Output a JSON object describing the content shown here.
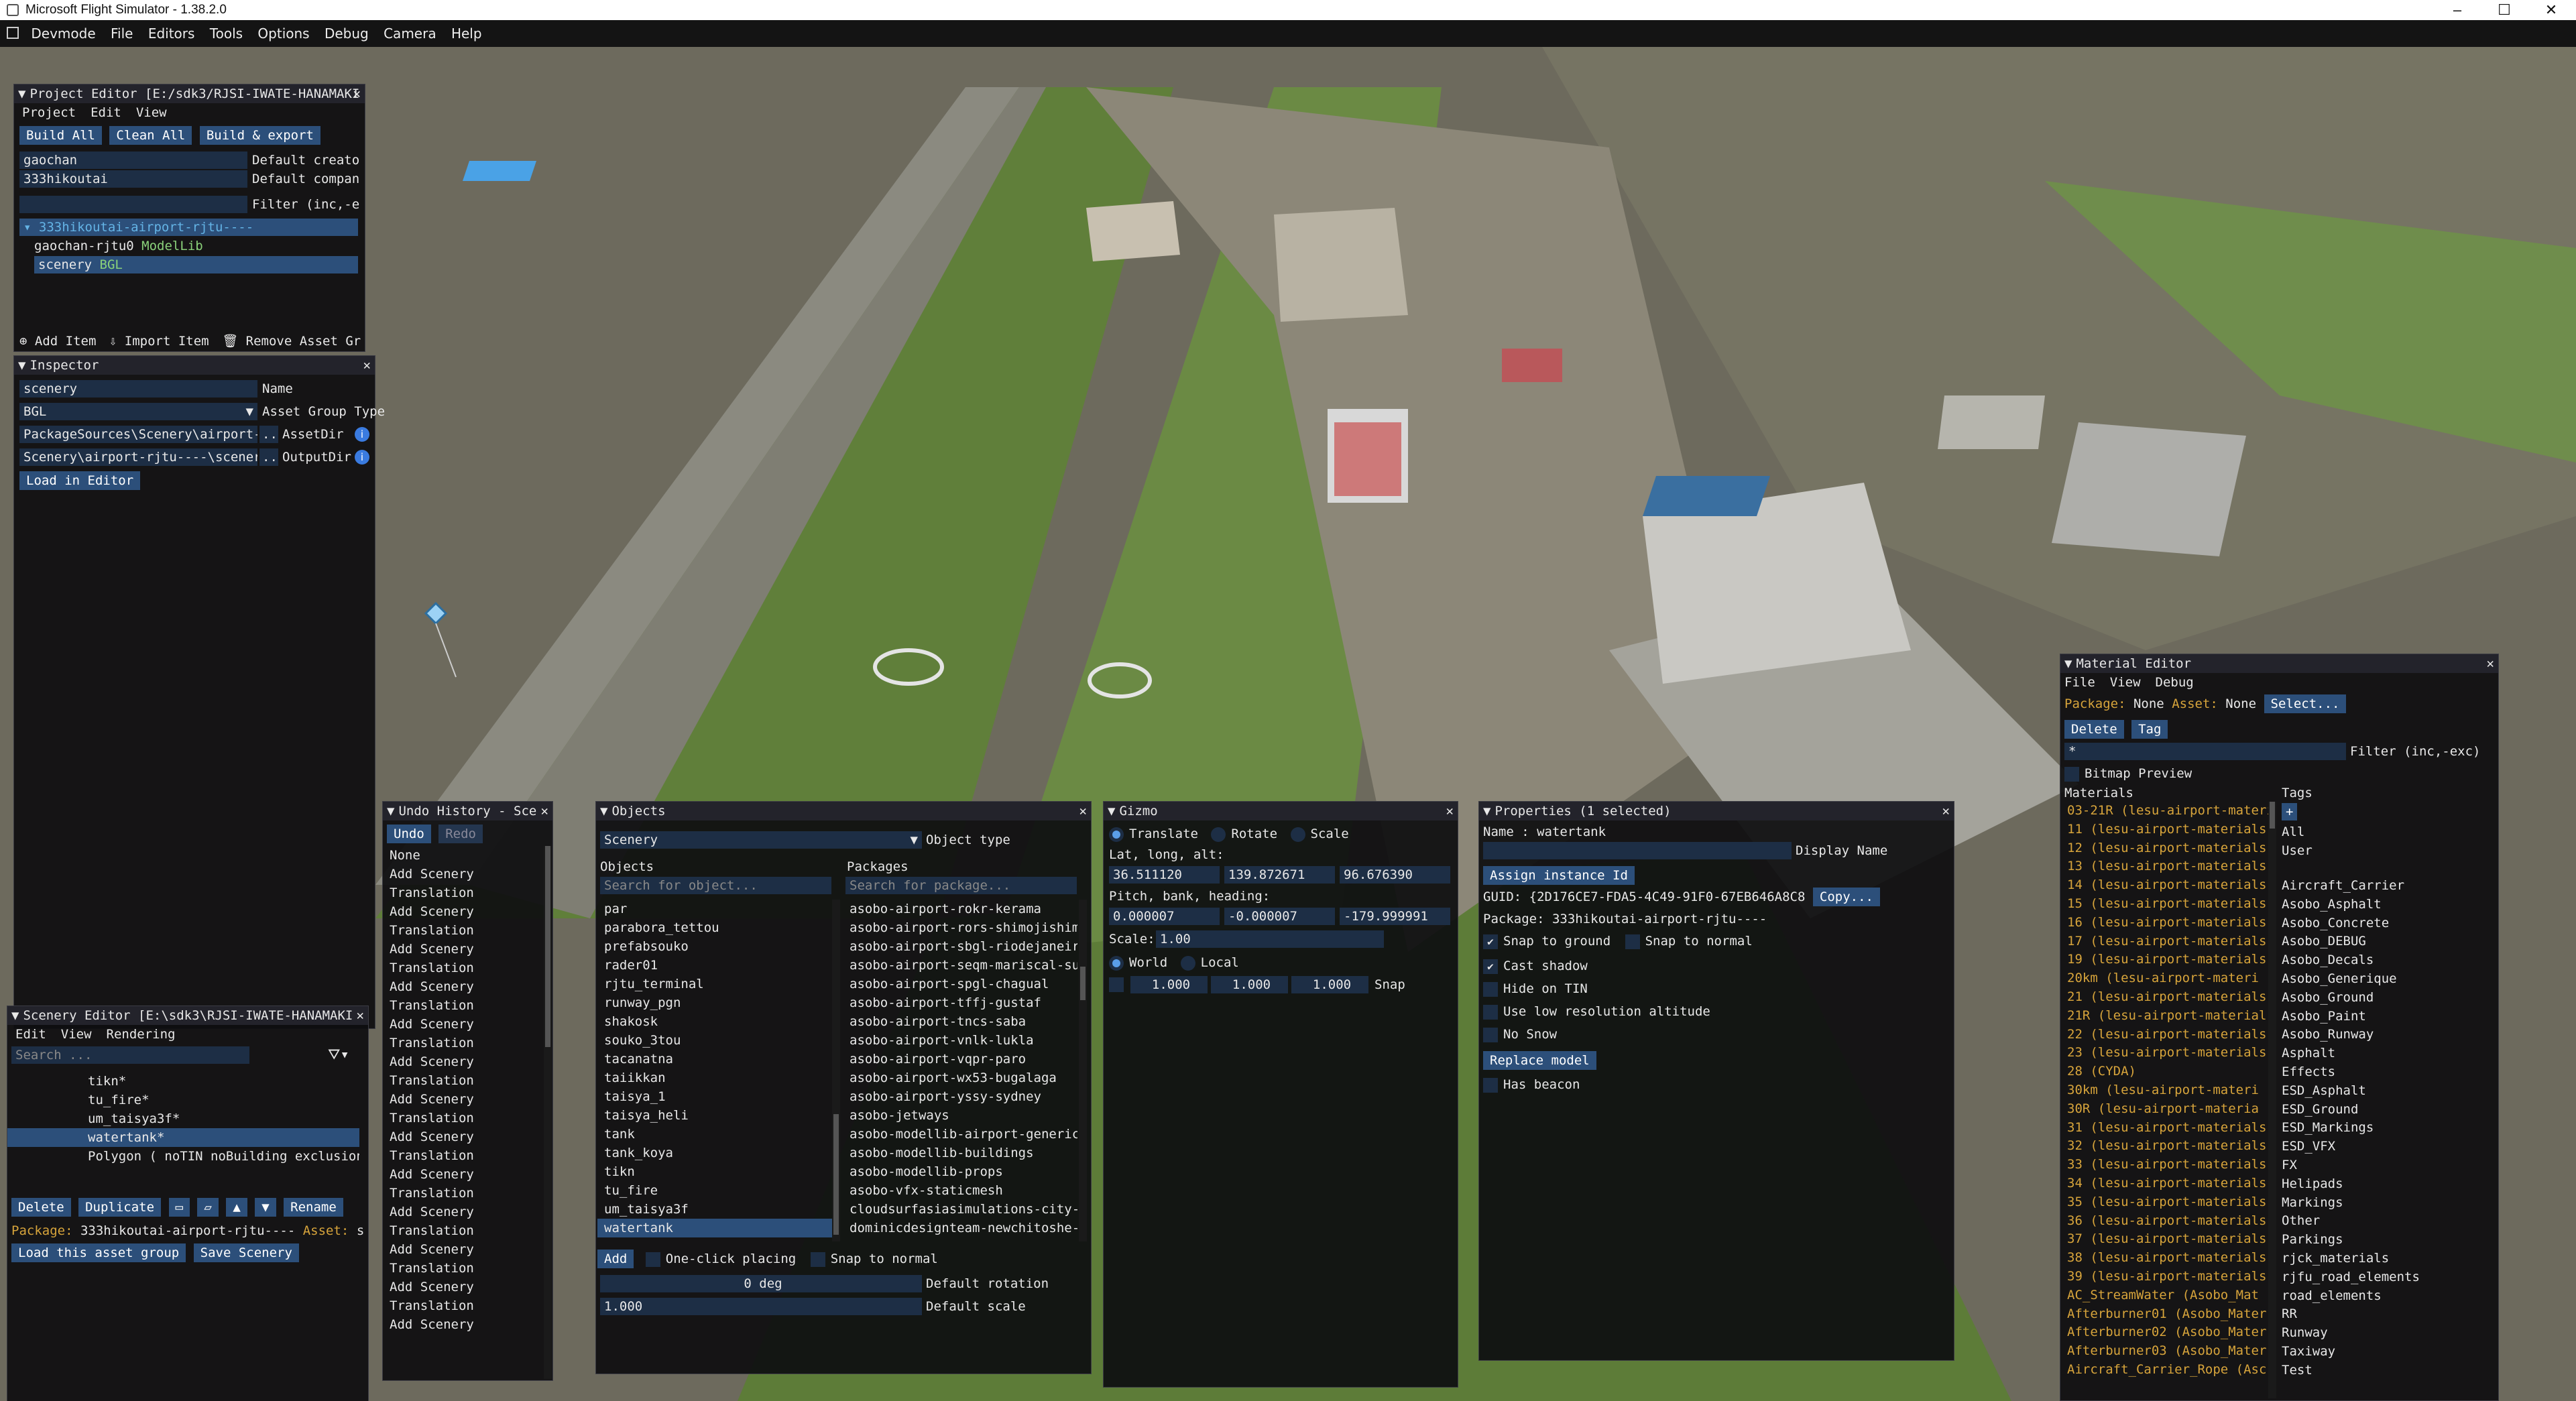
{
  "window": {
    "title": "Microsoft Flight Simulator - 1.38.2.0"
  },
  "menubar": {
    "items": [
      "Devmode",
      "File",
      "Editors",
      "Tools",
      "Options",
      "Debug",
      "Camera",
      "Help"
    ]
  },
  "project_editor": {
    "title": "Project Editor [E:/sdk3/RJSI-IWATE-HANAMAKI",
    "menu": [
      "Project",
      "Edit",
      "View"
    ],
    "buttons": [
      "Build All",
      "Clean All",
      "Build & export"
    ],
    "creator_value": "gaochan",
    "creator_label": "Default creato",
    "company_value": "333hikoutai",
    "company_label": "Default compan",
    "filter_label": "Filter (inc,-e",
    "tree_root": "333hikoutai-airport-rjtu----",
    "tree_items": [
      {
        "name": "gaochan-rjtu0",
        "type": "ModelLib"
      },
      {
        "name": "scenery",
        "type": "BGL"
      }
    ],
    "footer_buttons": [
      "Add Item",
      "Import Item",
      "Remove Asset Gr"
    ]
  },
  "inspector": {
    "title": "Inspector",
    "name_value": "scenery",
    "name_label": "Name",
    "type_value": "BGL",
    "type_label": "Asset Group Type",
    "assetdir_value": "PackageSources\\Scenery\\airport-r",
    "assetdir_label": "AssetDir",
    "outputdir_value": "Scenery\\airport-rjtu----\\scenery",
    "outputdir_label": "OutputDir",
    "dots": "..",
    "load_button": "Load in Editor"
  },
  "scenery_editor": {
    "title": "Scenery Editor [E:\\sdk3\\RJSI-IWATE-HANAMAKI",
    "menu": [
      "Edit",
      "View",
      "Rendering"
    ],
    "search_placeholder": "Search ...",
    "items": [
      "tikn*",
      "tu_fire*",
      "um_taisya3f*",
      "watertank*",
      "Polygon  ( noTIN noBuilding exclusion"
    ],
    "selected_index": 3,
    "buttons": {
      "delete": "Delete",
      "duplicate": "Duplicate",
      "rename": "Rename"
    },
    "package_label": "Package:",
    "package_value": "333hikoutai-airport-rjtu----",
    "asset_label": "Asset:",
    "asset_value": "sc",
    "load_button": "Load this asset group",
    "save_button": "Save Scenery"
  },
  "undo_history": {
    "title": "Undo History - Sce",
    "undo": "Undo",
    "redo": "Redo",
    "items": [
      "None",
      "Add Scenery",
      "Translation",
      "Add Scenery",
      "Translation",
      "Add Scenery",
      "Translation",
      "Add Scenery",
      "Translation",
      "Add Scenery",
      "Translation",
      "Add Scenery",
      "Translation",
      "Add Scenery",
      "Translation",
      "Add Scenery",
      "Translation",
      "Add Scenery",
      "Translation",
      "Add Scenery",
      "Translation",
      "Add Scenery",
      "Translation",
      "Add Scenery",
      "Translation",
      "Add Scenery"
    ]
  },
  "objects": {
    "title": "Objects",
    "type_value": "Scenery",
    "type_label": "Object type",
    "objects_header": "Objects",
    "packages_header": "Packages",
    "search_object_placeholder": "Search for object...",
    "search_package_placeholder": "Search for package...",
    "object_list": [
      "par",
      "parabora_tettou",
      "prefabsouko",
      "rader01",
      "rjtu_terminal",
      "runway_pgn",
      "shakosk",
      "souko_3tou",
      "tacanatna",
      "taiikkan",
      "taisya_1",
      "taisya_heli",
      "tank",
      "tank_koya",
      "tikn",
      "tu_fire",
      "um_taisya3f",
      "watertank"
    ],
    "selected_object": 17,
    "package_list": [
      "asobo-airport-rokr-kerama",
      "asobo-airport-rors-shimojishim",
      "asobo-airport-sbgl-riodejaneir",
      "asobo-airport-seqm-mariscal-su",
      "asobo-airport-spgl-chagual",
      "asobo-airport-tffj-gustaf",
      "asobo-airport-tncs-saba",
      "asobo-airport-vnlk-lukla",
      "asobo-airport-vqpr-paro",
      "asobo-airport-wx53-bugalaga",
      "asobo-airport-yssy-sydney",
      "asobo-jetways",
      "asobo-modellib-airport-generic",
      "asobo-modellib-buildings",
      "asobo-modellib-props",
      "asobo-vfx-staticmesh",
      "cloudsurfasiasimulations-city-",
      "dominicdesignteam-newchitoshe-"
    ],
    "add_button": "Add",
    "one_click": "One-click placing",
    "snap_normal": "Snap to normal",
    "rotation_value": "0 deg",
    "rotation_label": "Default rotation",
    "scale_value": "1.000",
    "scale_label": "Default scale"
  },
  "gizmo": {
    "title": "Gizmo",
    "modes": [
      "Translate",
      "Rotate",
      "Scale"
    ],
    "active_mode": 0,
    "latlong_label": "Lat, long, alt:",
    "lat": "36.511120",
    "lon": "139.872671",
    "alt": "96.676390",
    "pbh_label": "Pitch, bank, heading:",
    "pitch": "0.000007",
    "bank": "-0.000007",
    "heading": "-179.999991",
    "scale_label": "Scale:",
    "scale_value": "1.00",
    "spaces": [
      "World",
      "Local"
    ],
    "active_space": 0,
    "snap_values": [
      "1.000",
      "1.000",
      "1.000"
    ],
    "snap_label": "Snap"
  },
  "properties": {
    "title": "Properties (1 selected)",
    "name_line": "Name : watertank",
    "display_name_label": "Display Name",
    "assign_button": "Assign instance Id",
    "guid_line": "GUID: {2D176CE7-FDA5-4C49-91F0-67EB646A8C8",
    "copy_button": "Copy...",
    "package_line": "Package: 333hikoutai-airport-rjtu----",
    "snap_ground": "Snap to ground",
    "snap_normal": "Snap to normal",
    "checks": [
      {
        "label": "Cast shadow",
        "checked": true
      },
      {
        "label": "Hide on TIN",
        "checked": false
      },
      {
        "label": "Use low resolution altitude",
        "checked": false
      },
      {
        "label": "No Snow",
        "checked": false
      }
    ],
    "replace_button": "Replace model",
    "has_beacon": "Has beacon"
  },
  "material_editor": {
    "title": "Material Editor",
    "menu": [
      "File",
      "View",
      "Debug"
    ],
    "package_label": "Package:",
    "package_value": "None",
    "asset_label": "Asset:",
    "asset_value": "None",
    "select_button": "Select...",
    "delete_button": "Delete",
    "tag_button": "Tag",
    "filter_value": "*",
    "filter_label": "Filter (inc,-exc)",
    "bitmap_preview": "Bitmap Preview",
    "materials_header": "Materials",
    "tags_header": "Tags",
    "materials": [
      "03-21R (lesu-airport-materi",
      "11 (lesu-airport-materials",
      "12 (lesu-airport-materials",
      "13 (lesu-airport-materials",
      "14 (lesu-airport-materials",
      "15 (lesu-airport-materials",
      "16 (lesu-airport-materials",
      "17 (lesu-airport-materials",
      "19 (lesu-airport-materials",
      "20km (lesu-airport-materi",
      "21 (lesu-airport-materials",
      "21R (lesu-airport-material",
      "22 (lesu-airport-materials",
      "23 (lesu-airport-materials",
      "28 (CYDA)",
      "30km (lesu-airport-materi",
      "30R (lesu-airport-materia",
      "31 (lesu-airport-materials",
      "32 (lesu-airport-materials",
      "33 (lesu-airport-materials",
      "34 (lesu-airport-materials",
      "35 (lesu-airport-materials",
      "36 (lesu-airport-materials",
      "37 (lesu-airport-materials",
      "38 (lesu-airport-materials",
      "39 (lesu-airport-materials",
      "AC_StreamWater (Asobo_Mat",
      "Afterburner01 (Asobo_Mater",
      "Afterburner02 (Asobo_Mater",
      "Afterburner03 (Asobo_Mater",
      "Aircraft_Carrier_Rope (Asc"
    ],
    "tag_add": "+",
    "tags_top": [
      "All",
      "User"
    ],
    "tags": [
      "Aircraft_Carrier",
      "Asobo_Asphalt",
      "Asobo_Concrete",
      "Asobo_DEBUG",
      "Asobo_Decals",
      "Asobo_Generique",
      "Asobo_Ground",
      "Asobo_Paint",
      "Asobo_Runway",
      "Asphalt",
      "Effects",
      "ESD_Asphalt",
      "ESD_Ground",
      "ESD_Markings",
      "ESD_VFX",
      "FX",
      "Helipads",
      "Markings",
      "Other",
      "Parkings",
      "rjck_materials",
      "rjfu_road_elements",
      "road_elements",
      "RR",
      "Runway",
      "Taxiway",
      "Test"
    ]
  }
}
